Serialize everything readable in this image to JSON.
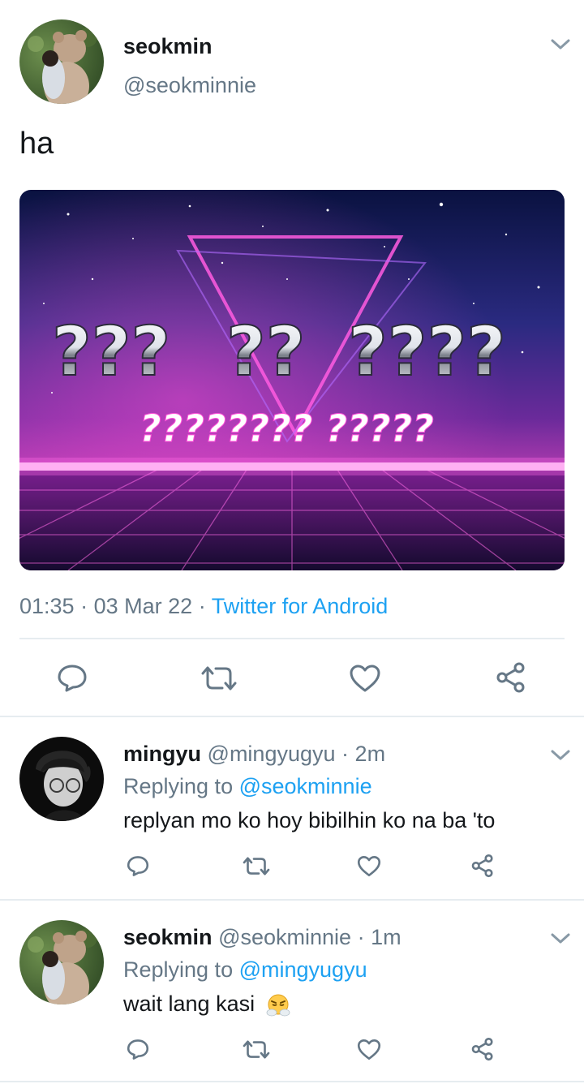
{
  "main_tweet": {
    "display_name": "seokmin",
    "handle": "@seokminnie",
    "text": "ha",
    "image_text": {
      "line1": [
        "???",
        "??",
        "????"
      ],
      "line2": "???????? ?????"
    },
    "time": "01:35",
    "sep1": "·",
    "date": "03 Mar 22",
    "sep2": "·",
    "source": "Twitter for Android"
  },
  "replies": [
    {
      "display_name": "mingyu",
      "handle": "@mingyugyu",
      "sep": "·",
      "age": "2m",
      "replying_label": "Replying to",
      "replying_to": "@seokminnie",
      "text": "replyan mo ko hoy bibilhin ko na ba 'to"
    },
    {
      "display_name": "seokmin",
      "handle": "@seokminnie",
      "sep": "·",
      "age": "1m",
      "replying_label": "Replying to",
      "replying_to": "@mingyugyu",
      "text": "wait lang kasi"
    }
  ],
  "icons": {
    "reply": "reply-icon",
    "retweet": "retweet-icon",
    "like": "like-icon",
    "share": "share-icon",
    "menu": "chevron-down-icon",
    "emoji": "steam-from-nose-emoji"
  },
  "colors": {
    "accent": "#1da1f2",
    "secondary_text": "#657786",
    "icon": "#657786",
    "divider": "#e6ecf0"
  }
}
